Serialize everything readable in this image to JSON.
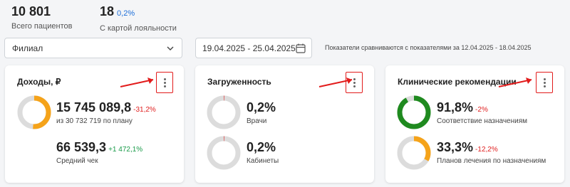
{
  "stats": {
    "patients": {
      "value": "10 801",
      "label": "Всего пациентов"
    },
    "loyalty": {
      "value": "18",
      "percent": "0,2%",
      "label": "С картой лояльности"
    }
  },
  "filters": {
    "branch": {
      "value": "Филиал",
      "icon": "chevron-down-icon"
    },
    "date_range": {
      "value": "19.04.2025 - 25.04.2025",
      "icon": "calendar-icon"
    },
    "compare_note": "Показатели сравниваются с показателями за 12.04.2025 - 18.04.2025"
  },
  "cards": {
    "income": {
      "title": "Доходы, ₽",
      "m1": {
        "value": "15 745 089,8",
        "change": "-31,2%",
        "sub": "из 30 732 719 по плану",
        "fill": 0.512,
        "color": "#f5a31a"
      },
      "m2": {
        "value": "66 539,3",
        "change": "+1 472,1%",
        "sub": "Средний чек"
      }
    },
    "load": {
      "title": "Загруженность",
      "m1": {
        "value": "0,2%",
        "sub": "Врачи",
        "fill": 0.002,
        "color": "#e02020"
      },
      "m2": {
        "value": "0,2%",
        "sub": "Кабинеты",
        "fill": 0.002,
        "color": "#e02020"
      }
    },
    "clinical": {
      "title": "Клинические рекомендации",
      "m1": {
        "value": "91,8%",
        "change": "-2%",
        "sub": "Соответствие назначениям",
        "fill": 0.918,
        "color": "#1f8a1f"
      },
      "m2": {
        "value": "33,3%",
        "change": "-12,2%",
        "sub": "Планов лечения по назначениям",
        "fill": 0.333,
        "color": "#f5a31a"
      }
    }
  },
  "colors": {
    "accent": "#1e6fd9",
    "negative": "#e02020",
    "positive": "#1a9b4a",
    "highlight": "#e21b1b"
  }
}
